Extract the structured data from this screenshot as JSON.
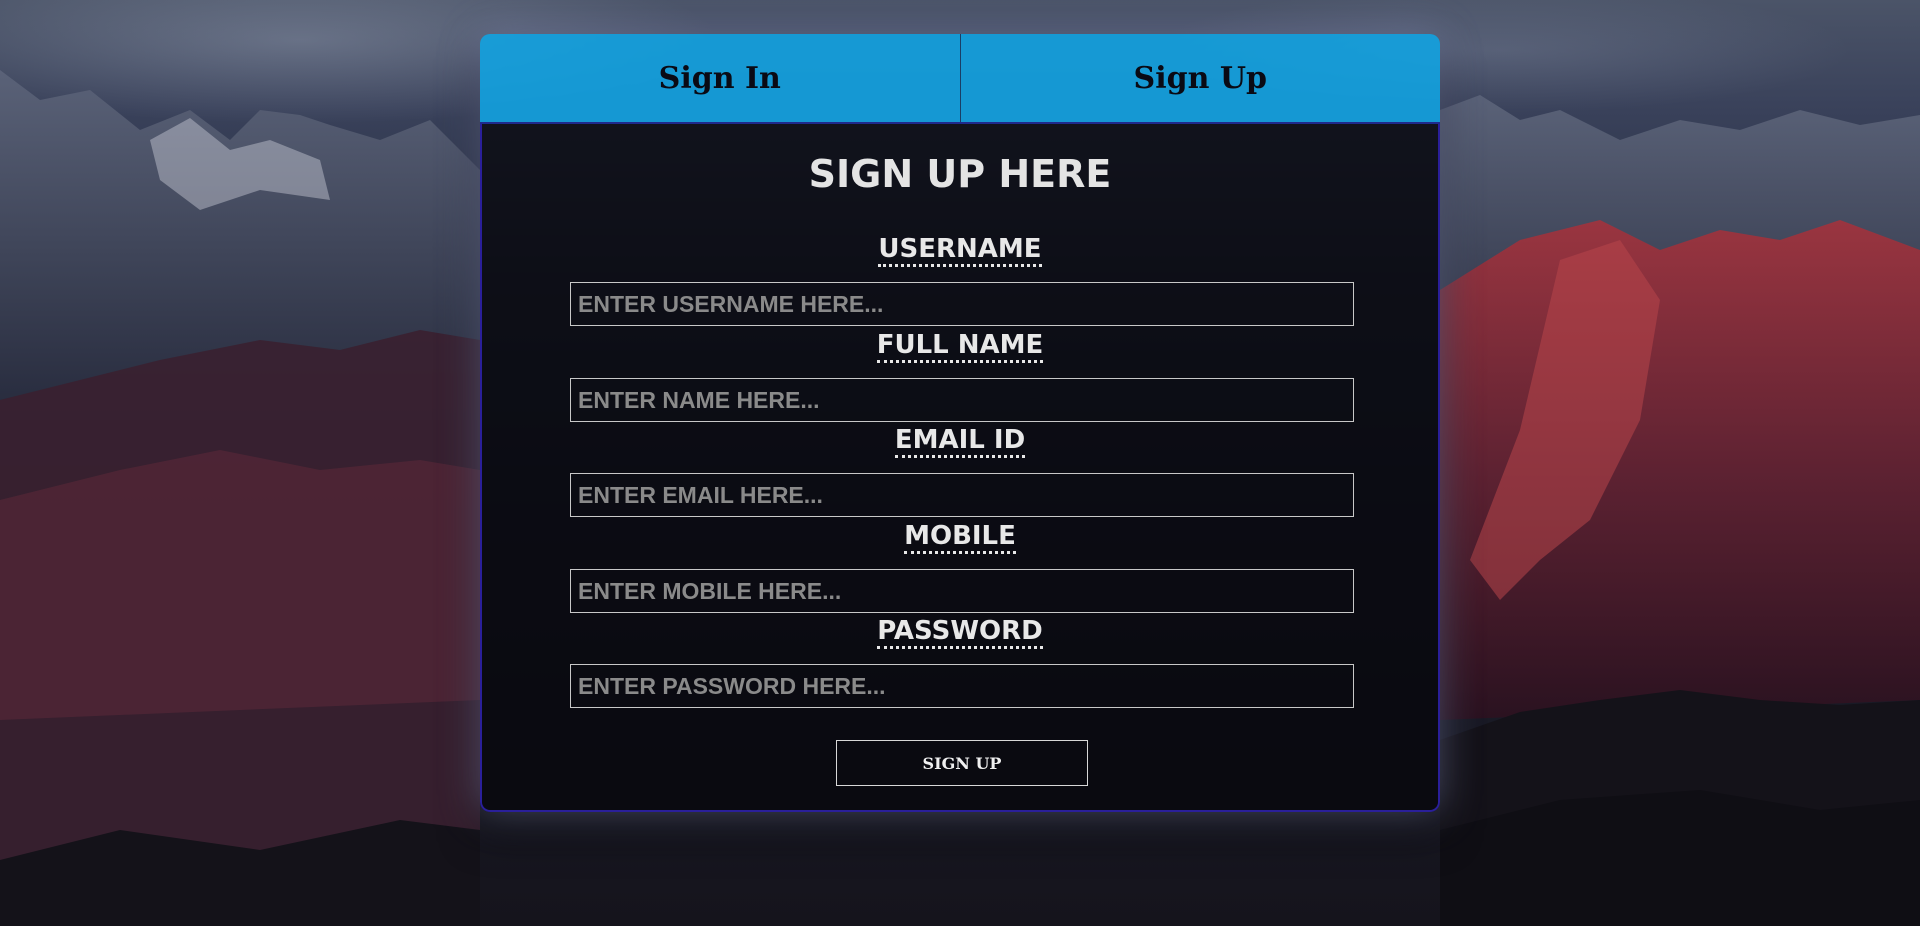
{
  "tabs": [
    {
      "label": "Sign In"
    },
    {
      "label": "Sign Up"
    }
  ],
  "form": {
    "title": "SIGN UP HERE",
    "fields": [
      {
        "label": "USERNAME",
        "placeholder": "ENTER USERNAME HERE..."
      },
      {
        "label": "FULL NAME",
        "placeholder": "ENTER NAME HERE..."
      },
      {
        "label": "EMAIL ID",
        "placeholder": "ENTER EMAIL HERE..."
      },
      {
        "label": "MOBILE",
        "placeholder": "ENTER MOBILE HERE..."
      },
      {
        "label": "PASSWORD",
        "placeholder": "ENTER PASSWORD HERE..."
      }
    ],
    "submit_label": "SIGN UP"
  },
  "colors": {
    "tab_bar": "#10a4e4",
    "panel_border": "#2a1f9a",
    "panel_background": "#06060c"
  }
}
